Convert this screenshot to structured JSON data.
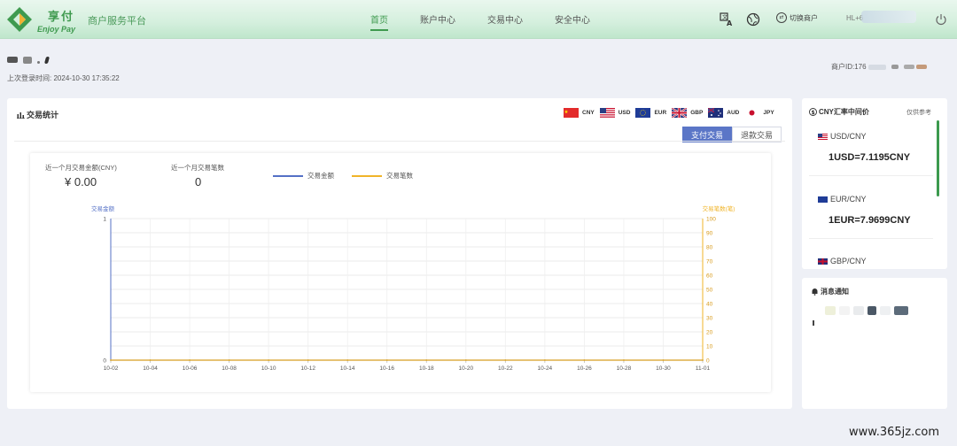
{
  "header": {
    "brand_cn": "享付",
    "brand_en": "Enjoy Pay",
    "platform": "商户服务平台",
    "nav": [
      {
        "label": "首页",
        "active": true
      },
      {
        "label": "账户中心",
        "active": false
      },
      {
        "label": "交易中心",
        "active": false
      },
      {
        "label": "安全中心",
        "active": false
      }
    ],
    "switch_merchant": "切换商户",
    "user_prefix": "HL+6",
    "accent_color": "#3f9a4f"
  },
  "account": {
    "last_login_label": "上次登录时间:",
    "last_login_time": "2024-10-30 17:35:22",
    "merchant_id_label": "商户ID:",
    "merchant_id_partial": "176"
  },
  "stats": {
    "title": "交易统计",
    "currencies": [
      "CNY",
      "USD",
      "EUR",
      "GBP",
      "AUD",
      "JPY"
    ],
    "tabs": [
      {
        "label": "支付交易",
        "active": true
      },
      {
        "label": "退款交易",
        "active": false
      }
    ],
    "amount_label": "近一个月交易金额(CNY)",
    "amount_value": "¥ 0.00",
    "count_label": "近一个月交易笔数",
    "count_value": "0",
    "legend_amount": "交易金额",
    "legend_count": "交易笔数"
  },
  "chart_data": {
    "type": "line",
    "x": [
      "10-02",
      "10-04",
      "10-06",
      "10-08",
      "10-10",
      "10-12",
      "10-14",
      "10-16",
      "10-18",
      "10-20",
      "10-22",
      "10-24",
      "10-26",
      "10-28",
      "10-30",
      "11-01"
    ],
    "series": [
      {
        "name": "交易金额",
        "values": [
          0,
          0,
          0,
          0,
          0,
          0,
          0,
          0,
          0,
          0,
          0,
          0,
          0,
          0,
          0,
          0
        ],
        "color": "#5470c6"
      },
      {
        "name": "交易笔数",
        "values": [
          0,
          0,
          0,
          0,
          0,
          0,
          0,
          0,
          0,
          0,
          0,
          0,
          0,
          0,
          0,
          0
        ],
        "color": "#f0b429"
      }
    ],
    "ylabel": "交易金额",
    "y2label": "交易笔数(笔)",
    "ylim": [
      0,
      1
    ],
    "y2lim": [
      0,
      100
    ],
    "y_ticks": [
      "0",
      "1"
    ],
    "y2_ticks": [
      "0",
      "10",
      "20",
      "30",
      "40",
      "50",
      "60",
      "70",
      "80",
      "90",
      "100"
    ],
    "grid": true
  },
  "rates": {
    "title": "CNY汇率中间价",
    "ref": "仅供参考",
    "items": [
      {
        "pair": "USD/CNY",
        "value": "1USD=7.1195CNY"
      },
      {
        "pair": "EUR/CNY",
        "value": "1EUR=7.9699CNY"
      },
      {
        "pair": "GBP/CNY",
        "value": ""
      }
    ]
  },
  "notice": {
    "title": "消息通知"
  },
  "watermark": "www.365jz.com"
}
